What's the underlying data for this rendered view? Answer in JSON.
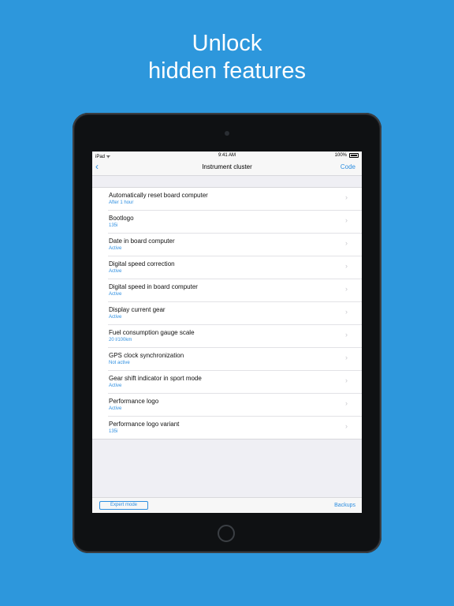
{
  "headline": {
    "line1": "Unlock",
    "line2": "hidden features"
  },
  "status": {
    "carrier": "iPad ᯤ",
    "time": "9:41 AM",
    "battery": "100%"
  },
  "nav": {
    "back_glyph": "‹",
    "title": "Instrument cluster",
    "code_label": "Code"
  },
  "settings": [
    {
      "title": "Automatically reset board computer",
      "value": "After 1 hour"
    },
    {
      "title": "Bootlogo",
      "value": "135i"
    },
    {
      "title": "Date in board computer",
      "value": "Active"
    },
    {
      "title": "Digital speed correction",
      "value": "Active"
    },
    {
      "title": "Digital speed in board computer",
      "value": "Active"
    },
    {
      "title": "Display current gear",
      "value": "Active"
    },
    {
      "title": "Fuel consumption gauge scale",
      "value": "20 l/100km"
    },
    {
      "title": "GPS clock synchronization",
      "value": "Not active"
    },
    {
      "title": "Gear shift indicator in sport mode",
      "value": "Active"
    },
    {
      "title": "Performance logo",
      "value": "Active"
    },
    {
      "title": "Performance logo variant",
      "value": "135i"
    }
  ],
  "chevron": "›",
  "toolbar": {
    "expert_label": "Expert mode",
    "backups_label": "Backups"
  },
  "colors": {
    "background": "#2d97dc",
    "accent": "#2d8ee0"
  },
  "icons": {
    "back": "chevron-left-icon",
    "row": "chevron-right-icon",
    "battery": "battery-icon",
    "wifi": "wifi-icon"
  }
}
